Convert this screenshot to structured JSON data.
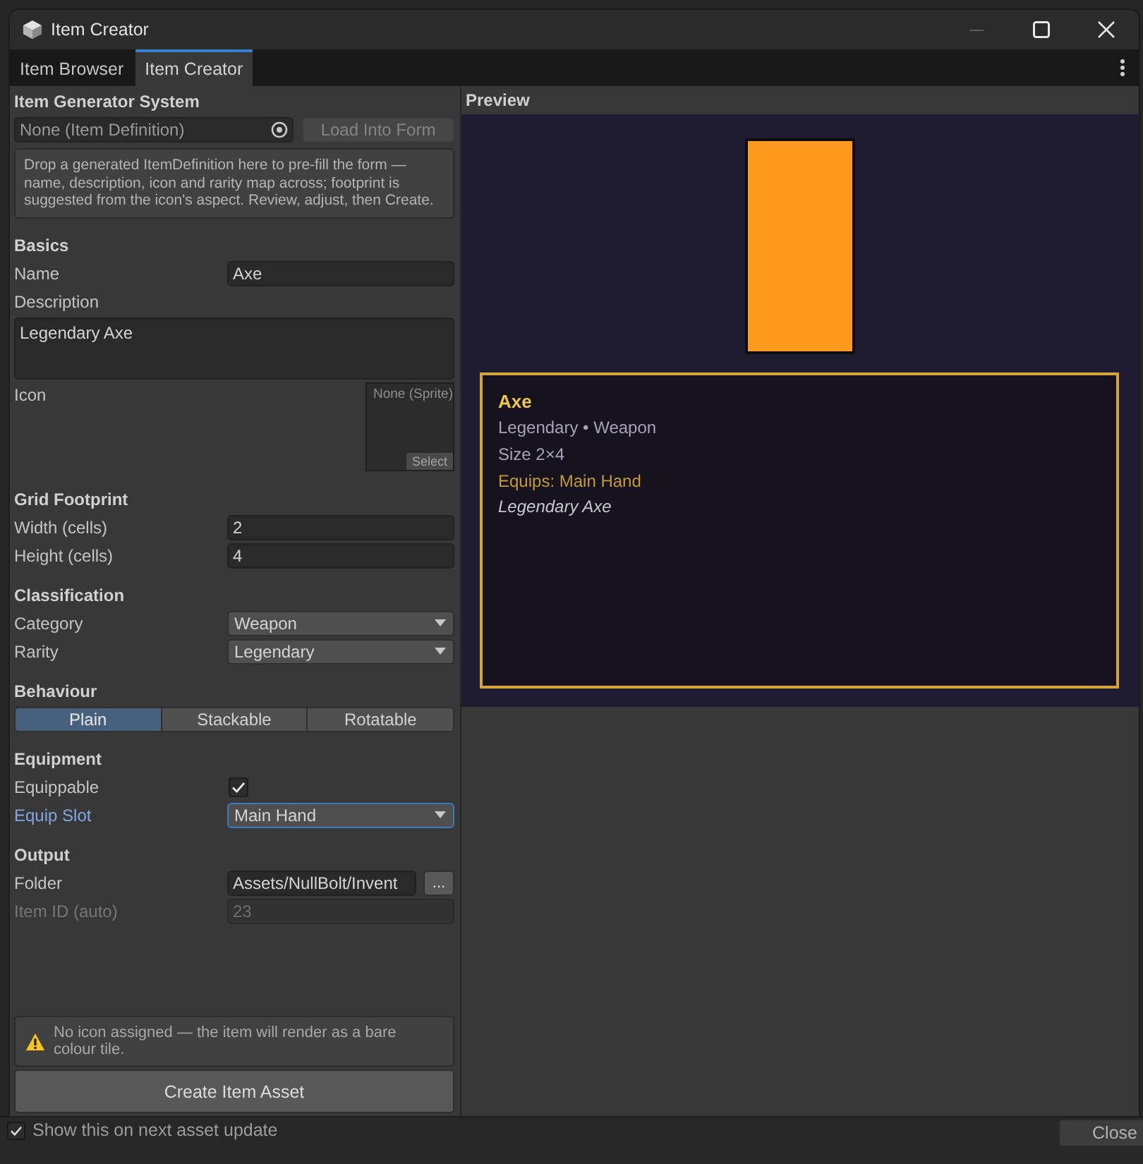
{
  "window": {
    "title": "Item Creator"
  },
  "tabs": [
    {
      "label": "Item Browser",
      "selected": false
    },
    {
      "label": "Item Creator",
      "selected": true
    }
  ],
  "generator": {
    "heading": "Item Generator System",
    "object_field": {
      "placeholder": "None (Item Definition)"
    },
    "load_button": {
      "label": "Load Into Form",
      "disabled": true
    },
    "help": "Drop a generated ItemDefinition here to pre-fill the form — name, description, icon and rarity map across; footprint is suggested from the icon's aspect. Review, adjust, then Create."
  },
  "sections": [
    {
      "heading": "Basics",
      "rows": [
        {
          "kind": "text",
          "label": "Name",
          "value": "Axe",
          "disabled": false
        },
        {
          "kind": "textarea",
          "label": "Description",
          "value": "Legendary Axe"
        },
        {
          "kind": "sprite",
          "label": "Icon",
          "placeholder": "None (Sprite)",
          "button": "Select"
        }
      ]
    },
    {
      "heading": "Grid Footprint",
      "rows": [
        {
          "kind": "text",
          "label": "Width (cells)",
          "value": "2",
          "disabled": false
        },
        {
          "kind": "text",
          "label": "Height (cells)",
          "value": "4",
          "disabled": false
        }
      ]
    },
    {
      "heading": "Classification",
      "rows": [
        {
          "kind": "dropdown",
          "label": "Category",
          "value": "Weapon",
          "focused": false
        },
        {
          "kind": "dropdown",
          "label": "Rarity",
          "value": "Legendary",
          "focused": false
        }
      ]
    },
    {
      "heading": "Behaviour",
      "rows": [
        {
          "kind": "segmented",
          "options": [
            {
              "label": "Plain",
              "selected": true
            },
            {
              "label": "Stackable",
              "selected": false
            },
            {
              "label": "Rotatable",
              "selected": false
            }
          ]
        }
      ]
    },
    {
      "heading": "Equipment",
      "rows": [
        {
          "kind": "checkbox",
          "label": "Equippable",
          "checked": true
        },
        {
          "kind": "dropdown",
          "label": "Equip Slot",
          "value": "Main Hand",
          "focused": true
        }
      ]
    },
    {
      "heading": "Output",
      "rows": [
        {
          "kind": "path",
          "label": "Folder",
          "value": "Assets/NullBolt/Invent",
          "button": "..."
        },
        {
          "kind": "text",
          "label": "Item ID (auto)",
          "value": "23",
          "disabled": true
        }
      ]
    }
  ],
  "warning": {
    "text": "No icon assigned — the item will render as a bare colour tile."
  },
  "create_button": {
    "label": "Create Item Asset"
  },
  "preview": {
    "heading": "Preview",
    "card": {
      "title": "Axe",
      "meta": "Legendary • Weapon",
      "size": "Size 2×4",
      "equips": "Equips: Main Hand",
      "description": "Legendary Axe"
    }
  },
  "footer": {
    "checkbox": {
      "label": "Show this on next asset update",
      "checked": true
    },
    "close_button": "Close"
  }
}
